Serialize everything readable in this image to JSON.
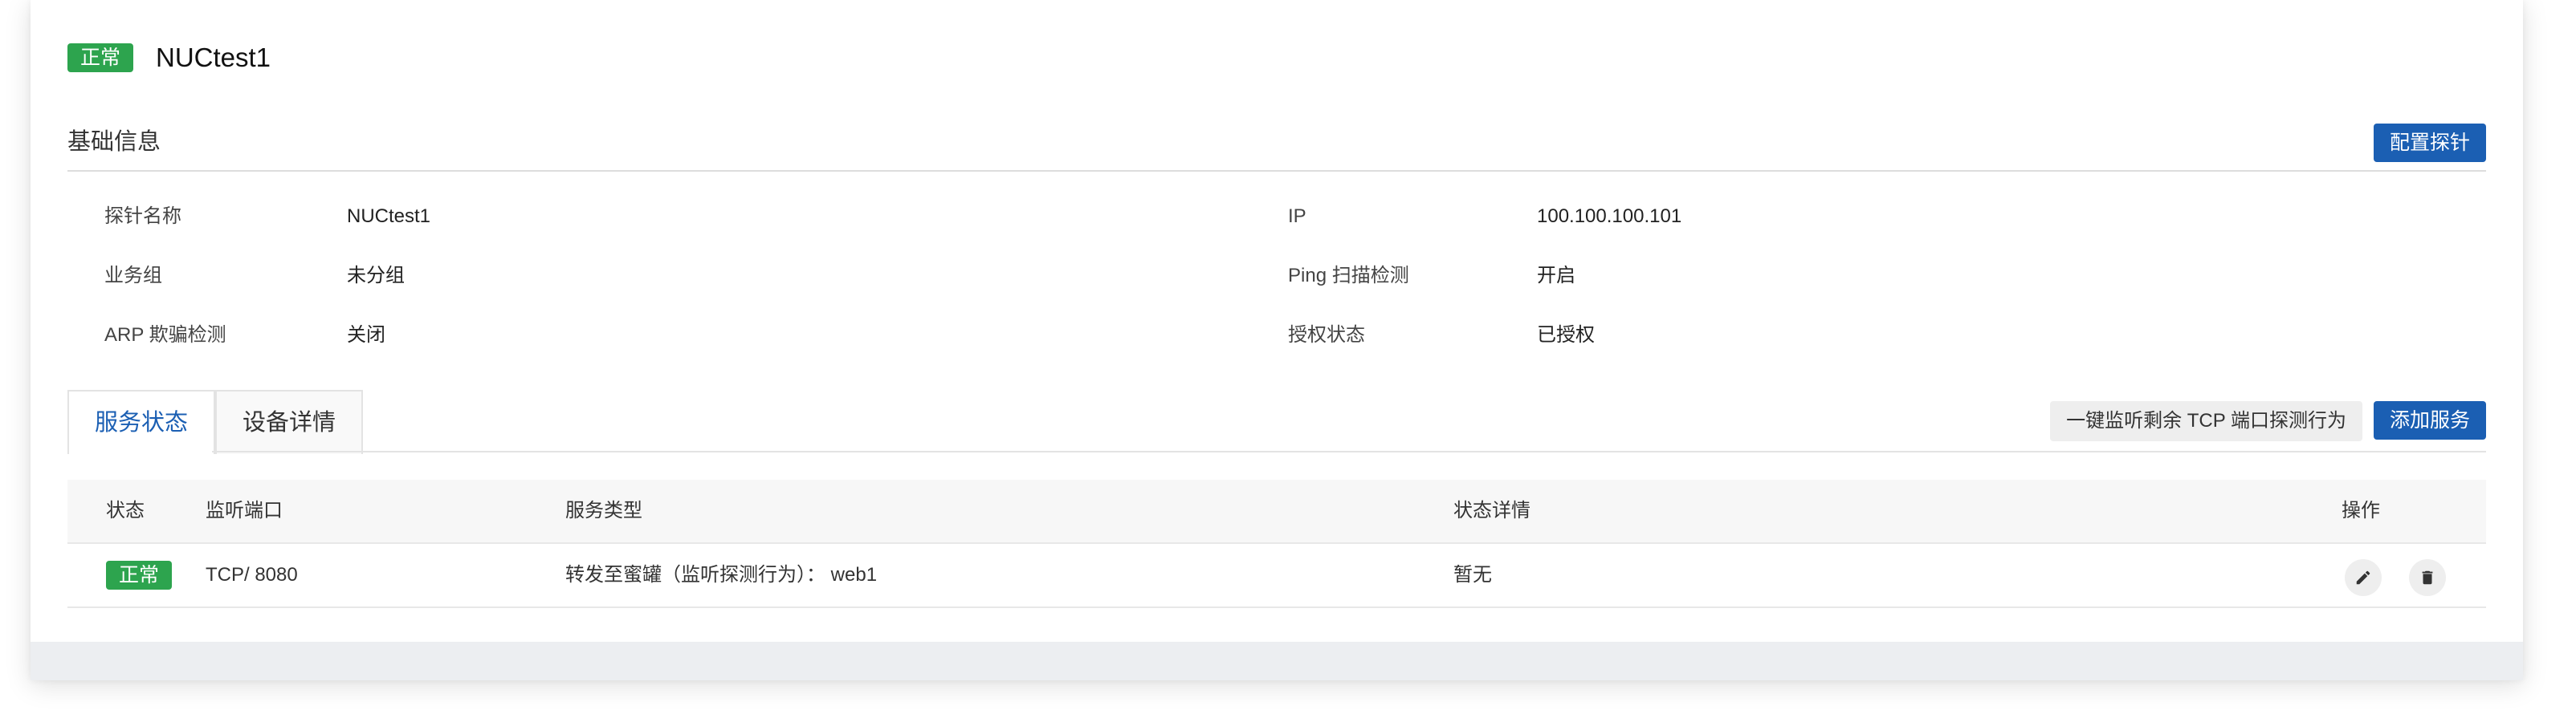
{
  "header": {
    "status_tag": "正常",
    "probe_name": "NUCtest1"
  },
  "basic_info": {
    "title": "基础信息",
    "config_button": "配置探针",
    "rows": [
      {
        "left_label": "探针名称",
        "left_value": "NUCtest1",
        "right_label": "IP",
        "right_value": "100.100.100.101"
      },
      {
        "left_label": "业务组",
        "left_value": "未分组",
        "right_label": "Ping 扫描检测",
        "right_value": "开启"
      },
      {
        "left_label": "ARP 欺骗检测",
        "left_value": "关闭",
        "right_label": "授权状态",
        "right_value": "已授权"
      }
    ]
  },
  "tabs": [
    {
      "label": "服务状态",
      "active": true
    },
    {
      "label": "设备详情",
      "active": false
    }
  ],
  "actions": {
    "monitor_button": "一键监听剩余 TCP 端口探测行为",
    "add_button": "添加服务"
  },
  "table": {
    "columns": [
      "状态",
      "监听端口",
      "服务类型",
      "状态详情",
      "操作"
    ],
    "rows": [
      {
        "status": "正常",
        "port": "TCP/ 8080",
        "service_type": "转发至蜜罐（监听探测行为）： web1",
        "detail": "暂无"
      }
    ]
  },
  "icons": {
    "edit": "pencil-icon",
    "delete": "trash-icon"
  },
  "colors": {
    "primary": "#1b5fb3",
    "success": "#2da44e",
    "footer": "#eceef1"
  }
}
